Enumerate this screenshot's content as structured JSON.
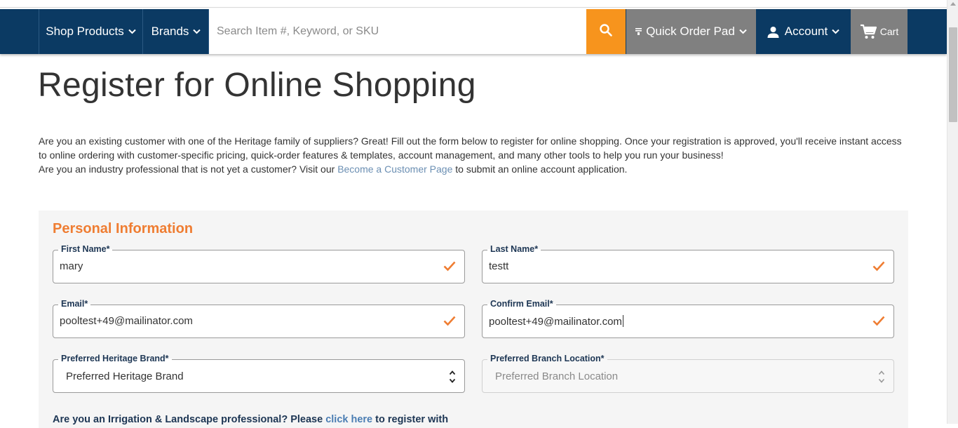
{
  "nav": {
    "shop_products": "Shop Products",
    "brands": "Brands",
    "search_placeholder": "Search Item #, Keyword, or SKU",
    "quick_order_pad": "Quick Order Pad",
    "account": "Account",
    "cart": "Cart"
  },
  "page": {
    "title": "Register for Online Shopping",
    "intro_line1": "Are you an existing customer with one of the Heritage family of suppliers? Great! Fill out the form below to register for online shopping. Once your registration is approved, you'll receive instant access to online ordering with customer-specific pricing, quick-order features & templates, account management, and many other tools to help you run your business!",
    "intro_line2_prefix": "Are you an industry professional that is not yet a customer? Visit our ",
    "intro_link": "Become a Customer Page",
    "intro_line2_suffix": " to submit an online account application."
  },
  "form": {
    "section_title": "Personal Information",
    "first_name": {
      "label": "First Name*",
      "value": "mary"
    },
    "last_name": {
      "label": "Last Name*",
      "value": "testt"
    },
    "email": {
      "label": "Email*",
      "value": "pooltest+49@mailinator.com"
    },
    "confirm_email": {
      "label": "Confirm Email*",
      "value": "pooltest+49@mailinator.com"
    },
    "preferred_brand": {
      "label": "Preferred Heritage Brand*",
      "value": "Preferred Heritage Brand"
    },
    "preferred_branch": {
      "label": "Preferred Branch Location*",
      "value": "Preferred Branch Location"
    },
    "irrigation_prefix": "Are you an Irrigation & Landscape professional? Please ",
    "irrigation_link": "click here",
    "irrigation_suffix": " to register with"
  },
  "colors": {
    "navy": "#0b3a63",
    "orange_accent": "#f7941d",
    "section_orange": "#ef7d32",
    "gray_button": "#808080"
  }
}
